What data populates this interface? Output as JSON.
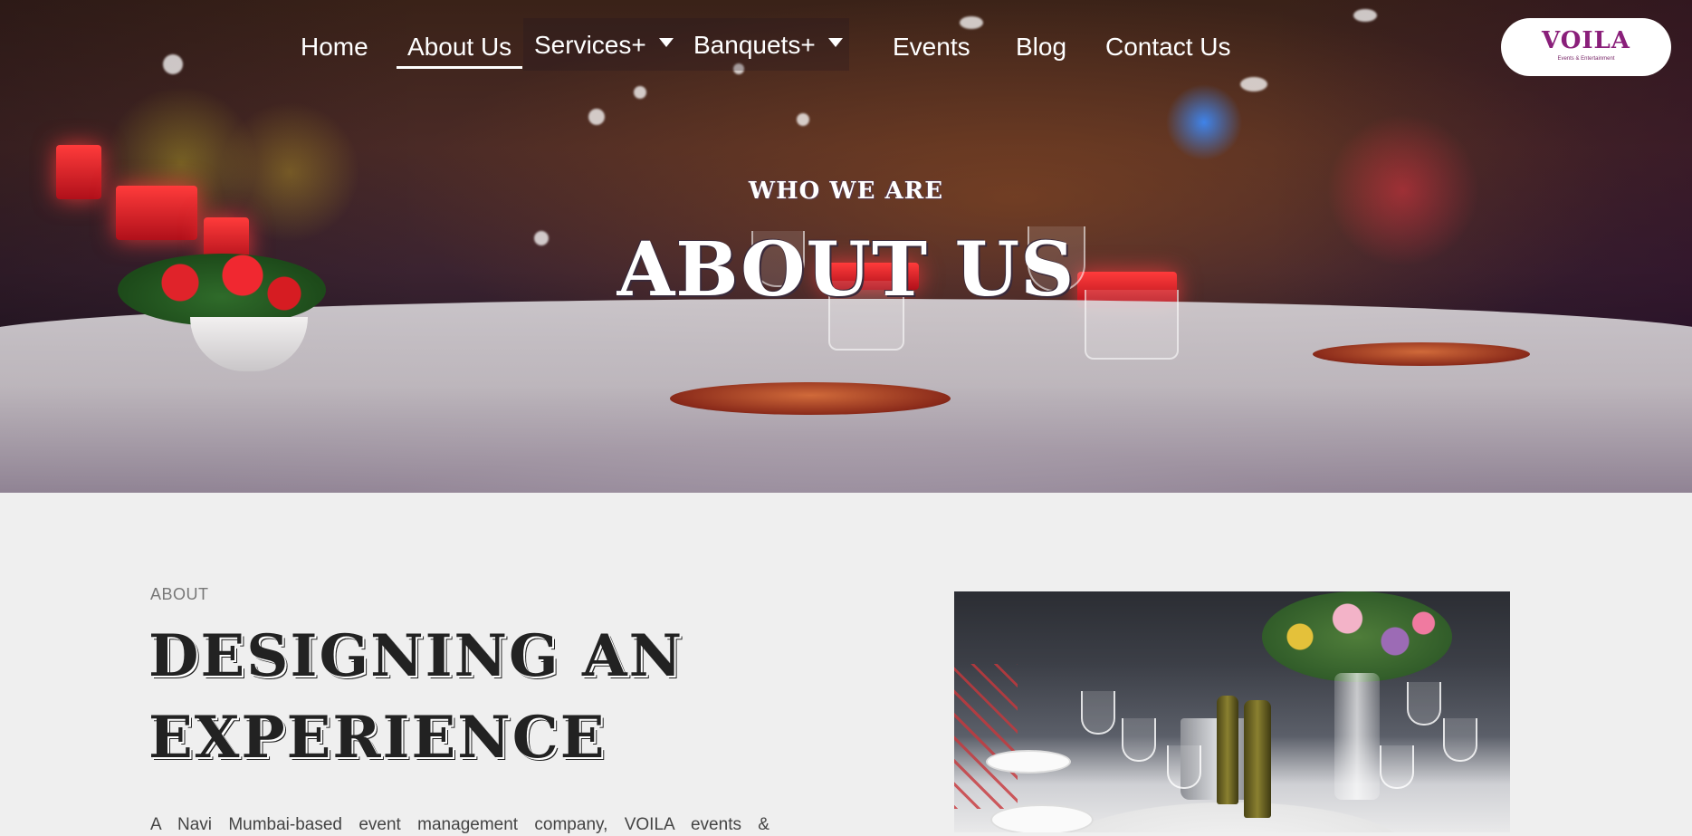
{
  "nav": {
    "items": [
      {
        "label": "Home",
        "active": false
      },
      {
        "label": "About Us",
        "active": true
      },
      {
        "label": "Services+",
        "dropdown": true
      },
      {
        "label": "Banquets+",
        "dropdown": true
      },
      {
        "label": "Events",
        "active": false
      },
      {
        "label": "Blog",
        "active": false
      },
      {
        "label": "Contact Us",
        "active": false
      }
    ],
    "logo": {
      "text": "VOILA",
      "tagline": "Events & Entertainment"
    }
  },
  "hero": {
    "eyebrow": "WHO WE ARE",
    "title": "ABOUT US"
  },
  "about": {
    "label": "ABOUT",
    "heading_line1": "DESIGNING AN",
    "heading_line2": "EXPERIENCE",
    "body": "A Navi Mumbai-based event management company, VOILA events &"
  },
  "colors": {
    "brand": "#8a1f7a",
    "page_bg": "#efefef",
    "heading": "#222222"
  }
}
